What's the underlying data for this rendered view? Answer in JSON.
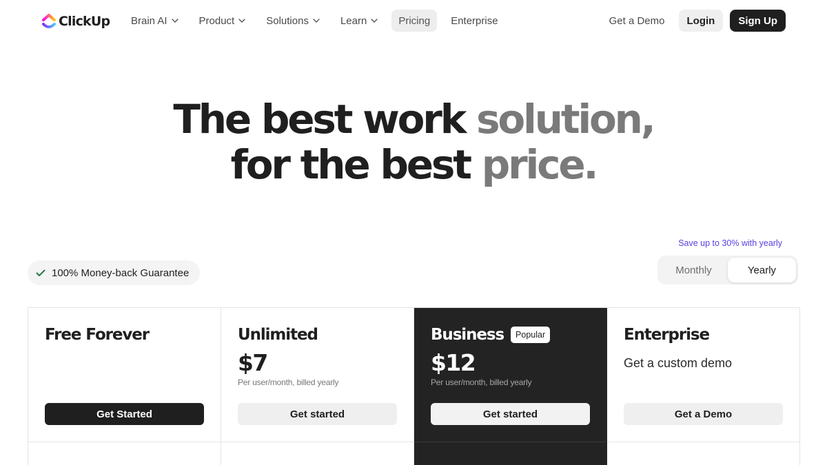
{
  "nav": {
    "logo_text": "ClickUp",
    "links": [
      {
        "label": "Brain AI",
        "dropdown": true
      },
      {
        "label": "Product",
        "dropdown": true
      },
      {
        "label": "Solutions",
        "dropdown": true
      },
      {
        "label": "Learn",
        "dropdown": true
      },
      {
        "label": "Pricing",
        "dropdown": false,
        "active": true
      },
      {
        "label": "Enterprise",
        "dropdown": false
      }
    ],
    "get_demo": "Get a Demo",
    "login": "Login",
    "signup": "Sign Up"
  },
  "hero": {
    "line1_strong": "The best work ",
    "line1_muted": "solution,",
    "line2_strong": "for the best ",
    "line2_muted": "price."
  },
  "guarantee": {
    "label": "100% Money-back Guarantee",
    "icon": "check-icon"
  },
  "billing": {
    "save_note": "Save up to 30% with yearly",
    "options": [
      "Monthly",
      "Yearly"
    ],
    "selected": "Yearly"
  },
  "plans": [
    {
      "name": "Free Forever",
      "price": "",
      "note": "",
      "cta": "Get Started"
    },
    {
      "name": "Unlimited",
      "price": "$7",
      "note": "Per user/month, billed yearly",
      "cta": "Get started"
    },
    {
      "name": "Business",
      "badge": "Popular",
      "price": "$12",
      "note": "Per user/month, billed yearly",
      "cta": "Get started"
    },
    {
      "name": "Enterprise",
      "subtitle": "Get a custom demo",
      "cta": "Get a Demo"
    }
  ],
  "colors": {
    "text": "#1f1f1f",
    "muted_headline": "#7a7a7a",
    "accent_note": "#5b3ee0",
    "dark_card": "#232323"
  }
}
